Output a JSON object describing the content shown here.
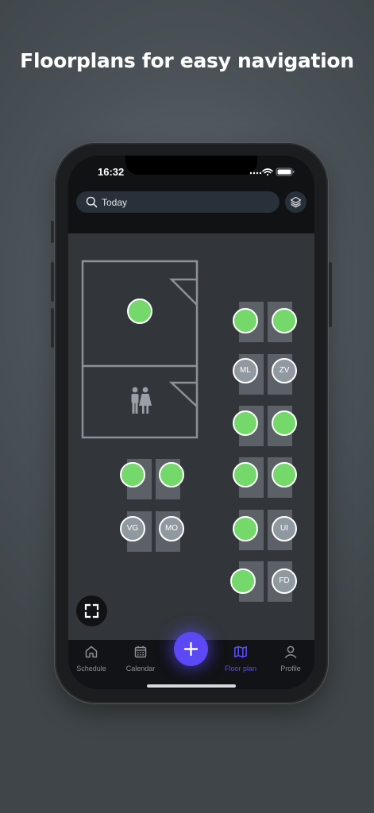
{
  "headline": "Floorplans for easy navigation",
  "status_bar": {
    "time": "16:32"
  },
  "search": {
    "label": "Today",
    "icon": "search-icon"
  },
  "layers_button": {
    "icon": "layers-icon"
  },
  "floorplan": {
    "rooms": [
      {
        "name": "meeting-room",
        "seats": 1
      },
      {
        "name": "restroom",
        "icon": "restroom-icon"
      }
    ],
    "seats": [
      {
        "status": "free",
        "initials": ""
      },
      {
        "status": "free",
        "initials": ""
      },
      {
        "status": "free",
        "initials": ""
      },
      {
        "status": "taken",
        "initials": "ML"
      },
      {
        "status": "taken",
        "initials": "ZV"
      },
      {
        "status": "free",
        "initials": ""
      },
      {
        "status": "free",
        "initials": ""
      },
      {
        "status": "free",
        "initials": ""
      },
      {
        "status": "free",
        "initials": ""
      },
      {
        "status": "free",
        "initials": ""
      },
      {
        "status": "free",
        "initials": ""
      },
      {
        "status": "taken",
        "initials": "VG"
      },
      {
        "status": "taken",
        "initials": "MO"
      },
      {
        "status": "free",
        "initials": ""
      },
      {
        "status": "taken",
        "initials": "UI"
      },
      {
        "status": "free",
        "initials": ""
      },
      {
        "status": "taken",
        "initials": "FD"
      }
    ]
  },
  "tabs": [
    {
      "label": "Schedule",
      "icon": "home-icon",
      "active": false
    },
    {
      "label": "Calendar",
      "icon": "calendar-icon",
      "active": false
    },
    {
      "label": "Floor plan",
      "icon": "map-icon",
      "active": true
    },
    {
      "label": "Profile",
      "icon": "person-icon",
      "active": false
    }
  ],
  "fab": {
    "icon": "plus-icon"
  },
  "colors": {
    "accent": "#5A49F5",
    "seat_free": "#74D86B",
    "seat_taken": "#8F999F",
    "map_background": "#32363B"
  }
}
